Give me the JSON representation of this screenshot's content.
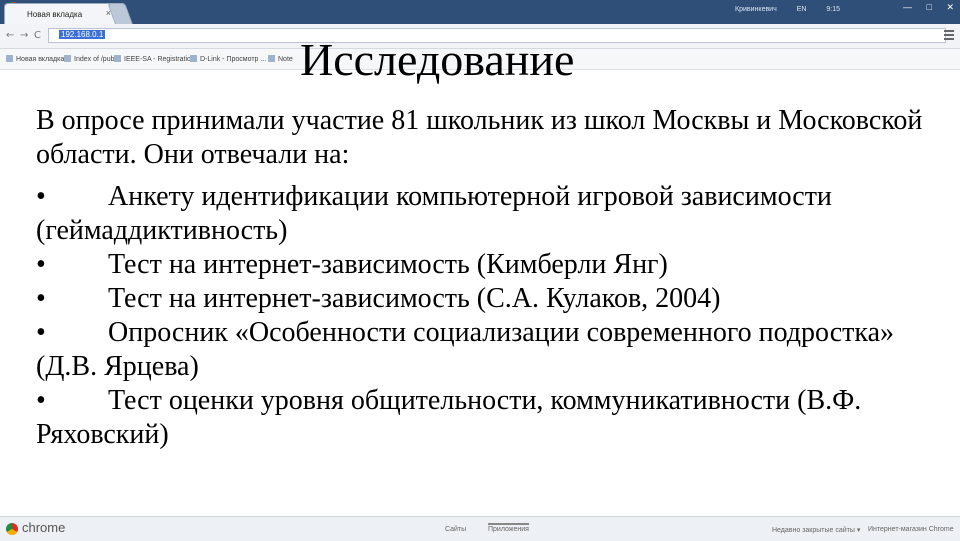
{
  "browser": {
    "tab_title": "Новая вкладка",
    "tab_close": "×",
    "new_tab": "",
    "window_info": [
      "Кривинкевич",
      "EN",
      "9:15"
    ],
    "window_buttons": [
      "—",
      "□",
      "✕"
    ],
    "nav": {
      "back": "←",
      "forward": "→",
      "reload": "C"
    },
    "url": "192.168.0.1",
    "bookmarks": [
      "Новая вкладка",
      "Index of /pub",
      "IEEE-SA - Registratio...",
      "D-Link - Просмотр ...",
      "Note"
    ]
  },
  "slide": {
    "title": "Исследование",
    "intro": "В опросе принимали участие 81 школьник из школ Москвы и Московской области. Они отвечали на:",
    "bullet_glyph": "•",
    "items": [
      "Анкету идентификации компьютерной игровой зависимости (геймаддиктивность)",
      "Тест на интернет-зависимость (Кимберли Янг)",
      "Тест на интернет-зависимость (С.А. Кулаков, 2004)",
      "Опросник «Особенности социализации современного подростка» (Д.В. Ярцева)",
      "Тест оценки уровня общительности, коммуникативности (В.Ф. Ряховский)"
    ]
  },
  "bottom": {
    "brand": "chrome",
    "tabs": [
      "Сайты",
      "Приложения"
    ],
    "right": [
      "Недавно закрытые сайты ▾",
      "Интернет-магазин Chrome"
    ]
  },
  "colors": {
    "titlebar": "#2f4f78",
    "url_highlight": "#3b6fd6"
  }
}
